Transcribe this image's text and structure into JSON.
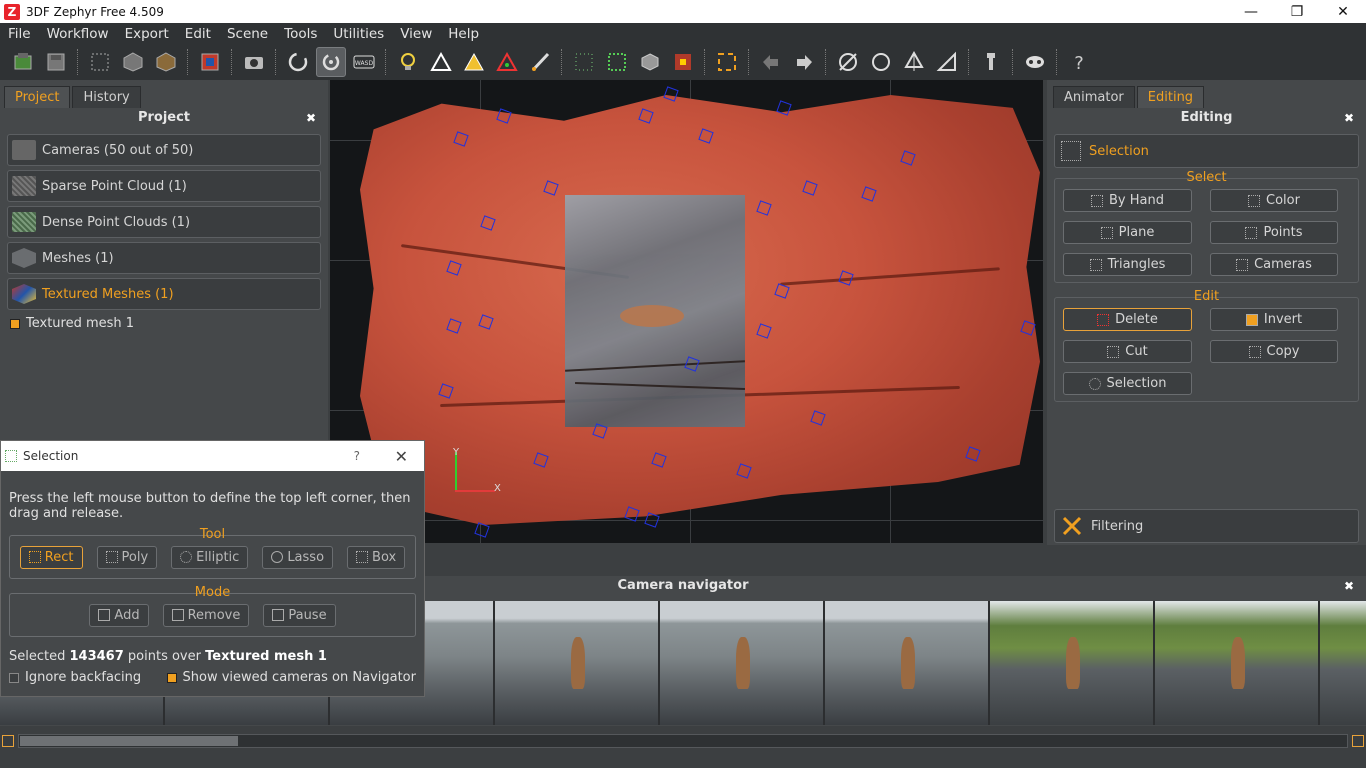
{
  "window": {
    "title": "3DF Zephyr Free 4.509",
    "app_icon": "Z",
    "controls": [
      "minimize",
      "restore",
      "close"
    ]
  },
  "menu": [
    "File",
    "Workflow",
    "Export",
    "Edit",
    "Scene",
    "Tools",
    "Utilities",
    "View",
    "Help"
  ],
  "left_panel": {
    "tabs": [
      "Project",
      "History"
    ],
    "active_tab": "Project",
    "header": "Project",
    "items": [
      {
        "label": "Cameras (50 out of 50)",
        "icon": "camera-icon"
      },
      {
        "label": "Sparse Point Cloud (1)",
        "icon": "sparse-cloud-icon"
      },
      {
        "label": "Dense Point Clouds (1)",
        "icon": "dense-cloud-icon"
      },
      {
        "label": "Meshes (1)",
        "icon": "mesh-icon"
      },
      {
        "label": "Textured Meshes (1)",
        "icon": "textured-mesh-icon"
      }
    ],
    "tree_item": "Textured mesh 1"
  },
  "right_panel": {
    "tabs": [
      "Animator",
      "Editing"
    ],
    "active_tab": "Editing",
    "header": "Editing",
    "selection_label": "Selection",
    "select_title": "Select",
    "select_buttons": [
      "By Hand",
      "Color",
      "Plane",
      "Points",
      "Triangles",
      "Cameras"
    ],
    "edit_title": "Edit",
    "edit_buttons": [
      "Delete",
      "Invert",
      "Cut",
      "Copy",
      "Selection"
    ],
    "filtering_label": "Filtering"
  },
  "viewport": {
    "axis_x": "X",
    "axis_y": "Y"
  },
  "dialog": {
    "title": "Selection",
    "help": "?",
    "instructions": "Press the left mouse button to define the top left corner, then drag and release.",
    "tool_title": "Tool",
    "tools": [
      "Rect",
      "Poly",
      "Elliptic",
      "Lasso",
      "Box"
    ],
    "active_tool": "Rect",
    "mode_title": "Mode",
    "modes": [
      "Add",
      "Remove",
      "Pause"
    ],
    "status_prefix": "Selected",
    "status_count": "143467",
    "status_mid": "points over",
    "status_target": "Textured mesh 1",
    "ignore_backfacing": "Ignore backfacing",
    "show_cameras": "Show viewed cameras on Navigator"
  },
  "camera_navigator": {
    "title": "Camera navigator"
  },
  "colors": {
    "accent": "#f0a020",
    "panel": "#45484a",
    "mesh": "#c7533d",
    "camera_marker": "#2233dd"
  }
}
